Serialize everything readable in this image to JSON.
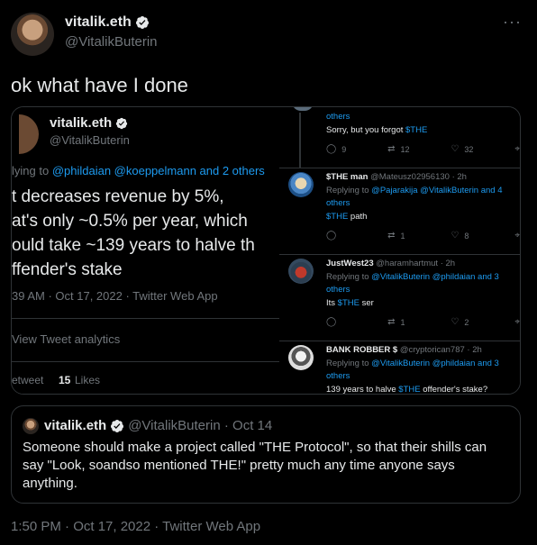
{
  "author": {
    "name": "vitalik.eth",
    "handle": "@VitalikButerin",
    "more_icon": "more-icon"
  },
  "tweet": {
    "text": "ok what have I done",
    "timestamp": "1:50 PM · Oct 17, 2022 · Twitter Web App"
  },
  "image_left": {
    "name": "vitalik.eth",
    "handle": "@VitalikButerin",
    "replying_prefix": "lying to ",
    "replying_mentions": "@phildaian @koeppelmann and 2 others",
    "body_lines": [
      "t decreases revenue by 5%,",
      "at's only ~0.5% per year, which",
      "ould take ~139 years to halve th",
      "ffender's stake"
    ],
    "time": "39 AM · Oct 17, 2022 · Twitter Web App",
    "analytics": "View Tweet analytics",
    "retweets_label": "etweet",
    "likes_count": "15",
    "likes_label": "Likes"
  },
  "image_right": {
    "posts": [
      {
        "reply_tail": "others",
        "text_prefix": "Sorry, but you forgot ",
        "text_tag": "$THE",
        "replies": "9",
        "retweets": "12",
        "likes": "32"
      },
      {
        "name": "$THE man",
        "handle": "@Mateusz02956130 · 2h",
        "reply_prefix": "Replying to ",
        "reply_mentions": "@Pajarakija @VitalikButerin and 4 others",
        "text_tag": "$THE",
        "text_suffix": " path",
        "replies": "",
        "retweets": "1",
        "likes": "8"
      },
      {
        "name": "JustWest23",
        "handle": "@haramhartmut · 2h",
        "reply_prefix": "Replying to ",
        "reply_mentions": "@VitalikButerin @phildaian and 3 others",
        "text_prefix": "Its ",
        "text_tag": "$THE",
        "text_suffix": " ser",
        "replies": "",
        "retweets": "1",
        "likes": "2"
      },
      {
        "name": "BANK ROBBER $",
        "handle": "@cryptorican787 · 2h",
        "reply_prefix": "Replying to ",
        "reply_mentions": "@VitalikButerin @phildaian and 3 others",
        "text_prefix": "139 years to halve ",
        "text_tag": "$THE",
        "text_suffix": " offender's stake?"
      }
    ]
  },
  "quote": {
    "name": "vitalik.eth",
    "handle": "@VitalikButerin · Oct 14",
    "text": "Someone should make a project called \"THE Protocol\", so that their shills can say \"Look, soandso mentioned THE!\" pretty much any time anyone says anything."
  },
  "colors": {
    "background": "#000000",
    "text": "#e7e9ea",
    "secondary": "#71767b",
    "accent": "#1d9bf0",
    "border": "#2f3336"
  }
}
